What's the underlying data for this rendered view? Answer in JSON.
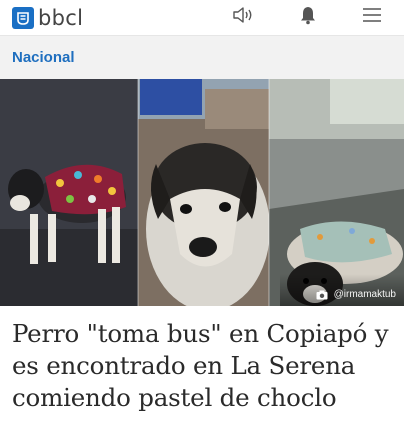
{
  "header": {
    "logo_text": "bbcl",
    "brand_color": "#1a6fc4",
    "icons": [
      "speaker-icon",
      "bell-icon",
      "menu-icon"
    ]
  },
  "section": {
    "label": "Nacional",
    "link_color": "#1f6fbf"
  },
  "article": {
    "photo_credit": "@irmamaktub",
    "headline": "Perro \"toma bus\" en Copiapó y es encontrado en La Serena comiendo pastel de choclo"
  }
}
